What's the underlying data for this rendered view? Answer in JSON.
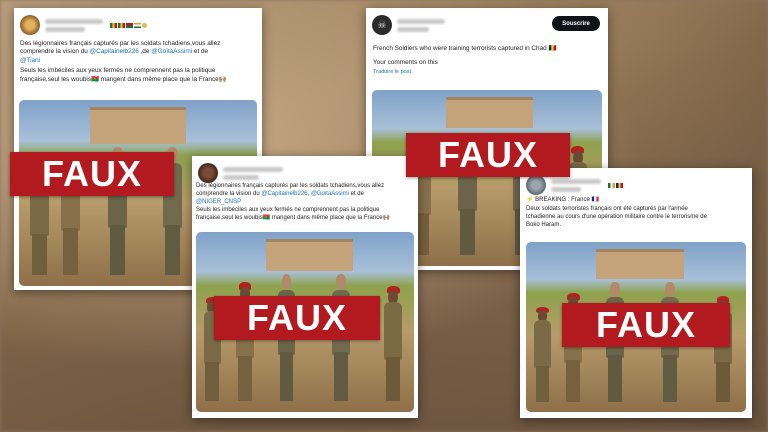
{
  "stamp": "FAUX",
  "colors": {
    "stamp_bg": "#b21a1f",
    "link": "#1d6fb8",
    "beret": "#b32020"
  },
  "post1": {
    "line1": "Des légionnaires français capturés par les soldats tchadiens,vous allez",
    "line2_pre": "comprendre la vision du ",
    "mention1": "@Capitainelb226",
    "line2_mid": " ,de ",
    "mention2": "@GoïtaAssimi",
    "line2_post": " et de",
    "mention3": "@Tiani",
    "line3": "Seuls les imbéciles aux yeux fermés ne comprennent pas la politique",
    "line4": "française,seul les woubis🇧🇫 mangent dans même place que la France🙌🏽"
  },
  "post2": {
    "line1": "French Soldiers who were training terrorists captured in Chad 🇹🇩",
    "line2": "Your comments on this",
    "translate": "Traduire le post",
    "subscribe": "Souscrire"
  },
  "post3": {
    "line1": "Des légionnaires français capturés par les soldats tchadiens,vous allez",
    "line2_pre": "comprendre la vision du ",
    "mention1": "@Capitainelb226",
    "line2_mid": ", ",
    "mention2": "@GoitaAssimi",
    "line2_post": " et de",
    "mention3": "@NIGER_CNSP",
    "line3": "Seuls les imbéciles aux yeux fermés ne comprennent pas la politique",
    "line4": "française,seul les woubis🇧🇫 mangent dans même place que la France🙌🏽"
  },
  "post4": {
    "line1": "⚡ BREAKING : France 🇫🇷",
    "line2": "Deux soldats terroristes français ont été capturés par l'armée",
    "line3": "tchadienne au cours d'une opération militaire contre le terrorisme de",
    "line4": "Boko Haram."
  }
}
